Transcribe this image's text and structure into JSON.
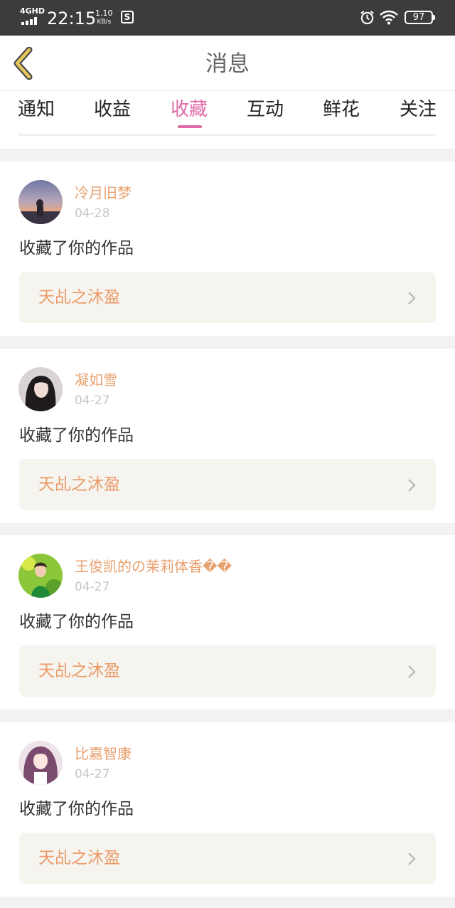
{
  "status_bar": {
    "network": "4GHD",
    "time": "22:15",
    "speed_value": "1.10",
    "speed_unit": "KB/s",
    "screenshot_glyph": "S",
    "battery": "97",
    "icons": [
      "signal-bars-icon",
      "screenshot-icon",
      "alarm-clock-icon",
      "wifi-icon",
      "battery-icon"
    ]
  },
  "header": {
    "title": "消息",
    "back_icon": "chevron-left-icon",
    "accent_color": "#e8c858"
  },
  "tabs": [
    {
      "label": "通知",
      "active": false
    },
    {
      "label": "收益",
      "active": false
    },
    {
      "label": "收藏",
      "active": true
    },
    {
      "label": "互动",
      "active": false
    },
    {
      "label": "鲜花",
      "active": false
    },
    {
      "label": "关注",
      "active": false
    }
  ],
  "colors": {
    "active_tab": "#e06aa7",
    "username": "#e8a06e",
    "work_title": "#ec9a68",
    "work_bg": "#f5f4ef",
    "page_bg": "#f3f1f1"
  },
  "notifications": [
    {
      "username": "冷月旧梦",
      "date": "04-28",
      "action": "收藏了你的作品",
      "work": "天乩之沐盈",
      "avatar": "dusk-landscape-avatar"
    },
    {
      "username": "凝如雪",
      "date": "04-27",
      "action": "收藏了你的作品",
      "work": "天乩之沐盈",
      "avatar": "dark-hair-portrait-avatar"
    },
    {
      "username": "王俊凯的の茉莉体香��",
      "date": "04-27",
      "action": "收藏了你的作品",
      "work": "天乩之沐盈",
      "avatar": "green-garden-portrait-avatar"
    },
    {
      "username": "比嘉智康",
      "date": "04-27",
      "action": "收藏了你的作品",
      "work": "天乩之沐盈",
      "avatar": "anime-girl-avatar"
    }
  ]
}
